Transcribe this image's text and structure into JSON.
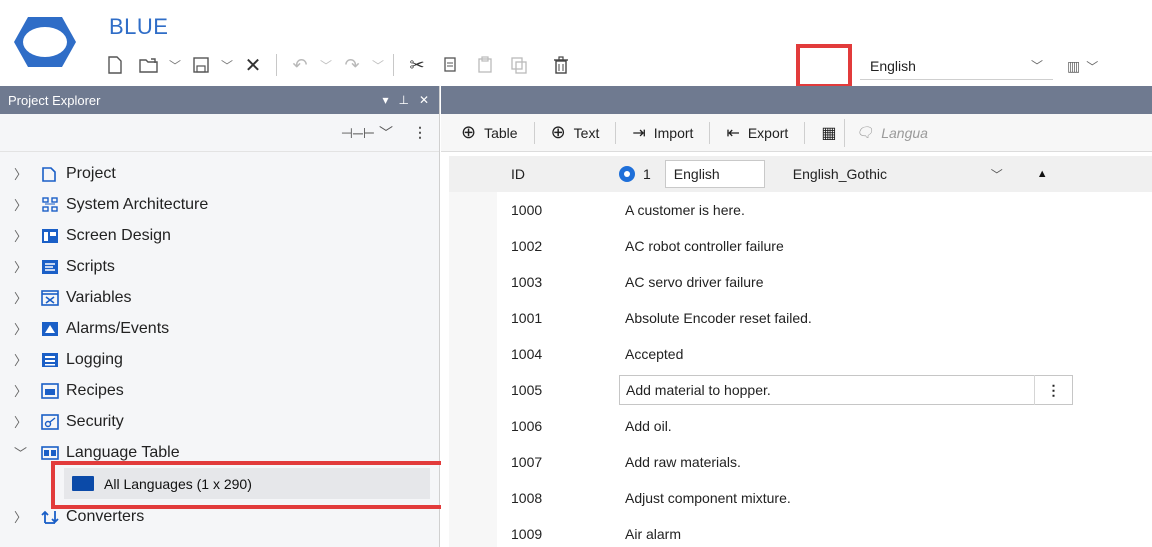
{
  "app": {
    "title": "BLUE"
  },
  "toolbar": {
    "language_select": "English",
    "colors": {
      "highlight": "#e23b3b",
      "accent": "#2f6dc7"
    }
  },
  "project_explorer": {
    "title": "Project Explorer",
    "tree": [
      {
        "label": "Project",
        "icon": "project-icon"
      },
      {
        "label": "System Architecture",
        "icon": "system-architecture-icon"
      },
      {
        "label": "Screen Design",
        "icon": "screen-design-icon"
      },
      {
        "label": "Scripts",
        "icon": "scripts-icon"
      },
      {
        "label": "Variables",
        "icon": "variables-icon"
      },
      {
        "label": "Alarms/Events",
        "icon": "alarms-icon"
      },
      {
        "label": "Logging",
        "icon": "logging-icon"
      },
      {
        "label": "Recipes",
        "icon": "recipes-icon"
      },
      {
        "label": "Security",
        "icon": "security-icon"
      },
      {
        "label": "Language Table",
        "icon": "language-table-icon"
      },
      {
        "label": "Converters",
        "icon": "converters-icon"
      }
    ],
    "selected_child": "All Languages (1 x 290)"
  },
  "language_table": {
    "toolbar": {
      "add_table": "Table",
      "add_text": "Text",
      "import": "Import",
      "export": "Export",
      "search_placeholder": "Langua"
    },
    "header": {
      "id": "ID",
      "column_number": "1",
      "language": "English",
      "font": "English_Gothic"
    },
    "rows": [
      {
        "id": "1000",
        "text": "A customer is here."
      },
      {
        "id": "1002",
        "text": "AC robot controller failure"
      },
      {
        "id": "1003",
        "text": "AC servo driver failure"
      },
      {
        "id": "1001",
        "text": "Absolute Encoder reset failed."
      },
      {
        "id": "1004",
        "text": "Accepted"
      },
      {
        "id": "1005",
        "text": "Add material to hopper."
      },
      {
        "id": "1006",
        "text": "Add oil."
      },
      {
        "id": "1007",
        "text": "Add raw materials."
      },
      {
        "id": "1008",
        "text": "Adjust component mixture."
      },
      {
        "id": "1009",
        "text": "Air alarm"
      }
    ]
  }
}
